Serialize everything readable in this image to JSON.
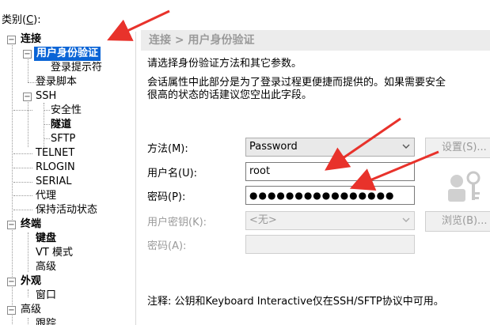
{
  "category": {
    "text": "类别(",
    "accel": "C",
    "close": "):"
  },
  "tree": {
    "items": [
      {
        "label": "连接",
        "bold": true
      },
      {
        "label": "用户身份验证",
        "bold": true,
        "selected": true
      },
      {
        "label": "登录提示符"
      },
      {
        "label": "登录脚本"
      },
      {
        "label": "SSH"
      },
      {
        "label": "安全性"
      },
      {
        "label": "隧道",
        "bold": true
      },
      {
        "label": "SFTP"
      },
      {
        "label": "TELNET"
      },
      {
        "label": "RLOGIN"
      },
      {
        "label": "SERIAL"
      },
      {
        "label": "代理"
      },
      {
        "label": "保持活动状态"
      },
      {
        "label": "终端",
        "bold": true
      },
      {
        "label": "键盘",
        "bold": true
      },
      {
        "label": "VT 模式"
      },
      {
        "label": "高级"
      },
      {
        "label": "外观",
        "bold": true
      },
      {
        "label": "窗口"
      },
      {
        "label": "高级"
      },
      {
        "label": "跟踪"
      }
    ]
  },
  "panel": {
    "breadcrumb": "连接 > 用户身份验证",
    "desc1": "请选择身份验证方法和其它参数。",
    "desc2": "会话属性中此部分是为了登录过程更便捷而提供的。如果需要安全",
    "desc3": "很高的状态的话建议您空出此字段。"
  },
  "form": {
    "method_label": "方法(M):",
    "method_value": "Password",
    "username_label": "用户名(U):",
    "username_value": "root",
    "password_label": "密码(P):",
    "password_value": "●●●●●●●●●●●●●●●●",
    "userkey_label": "用户密钥(K):",
    "userkey_value": "<无>",
    "passphrase_label": "密码(A):",
    "passphrase_value": ""
  },
  "buttons": {
    "settings": "设置(S)...",
    "browse": "浏览(B)..."
  },
  "note": "注释: 公钥和Keyboard Interactive仅在SSH/SFTP协议中可用。",
  "colors": {
    "selection": "#0a64d6",
    "annotation_arrow": "#e8322b"
  }
}
